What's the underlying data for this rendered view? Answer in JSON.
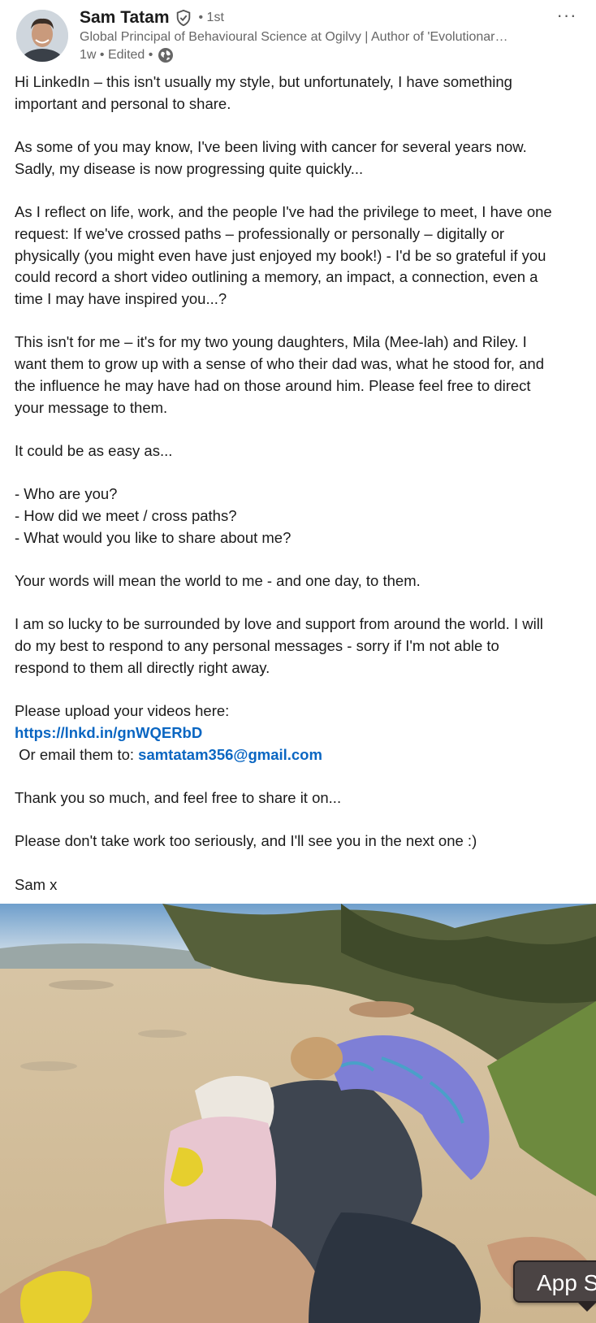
{
  "author": {
    "name": "Sam Tatam",
    "degree": "• 1st",
    "headline": "Global Principal of Behavioural Science at Ogilvy | Author of 'Evolutionar…",
    "meta": "1w • Edited •"
  },
  "icons": {
    "verified": "verified-shield-icon",
    "visibility": "globe-icon",
    "more": "more-options-icon"
  },
  "more_label": "···",
  "post": {
    "p1": [
      "Hi LinkedIn – this isn't usually my style, but unfortunately, I have something",
      "important and personal to share."
    ],
    "p2": [
      "As some of you may know, I've been living with cancer for several years now.",
      "Sadly, my disease is now progressing quite quickly..."
    ],
    "p3": [
      "As I reflect on life, work, and the people I've had the privilege to meet, I have one",
      "request: If we've crossed paths – professionally or personally – digitally or",
      "physically (you might even have just enjoyed my book!) -  I'd be so grateful if you",
      "could record a short video outlining a memory, an impact, a connection, even a",
      "time I may have inspired you...?"
    ],
    "p4": [
      "This isn't for me – it's for my two young daughters, Mila (Mee-lah) and Riley. I",
      "want them to grow up with a sense of who their dad was, what he stood for, and",
      "the influence he may have had on those around him. Please feel free to direct",
      "your message to them."
    ],
    "p5": "It could be as easy as...",
    "questions": [
      "- Who are you?",
      "- How did we meet / cross paths?",
      "- What would you like to share about me?"
    ],
    "p6": "Your words will mean the world to me - and one day, to them.",
    "p7": [
      "I am so lucky to be surrounded by love and support from around the world. I will",
      "do my best to respond to any personal messages - sorry if I'm not able to",
      "respond to them all directly right away."
    ],
    "upload_prompt": "Please upload your videos here:",
    "upload_link": "https://lnkd.in/gnWQERbD",
    "email_prompt": " Or email them to: ",
    "email": "samtatam356@gmail.com",
    "p8": "Thank you so much, and feel free to share it on...",
    "p9": "Please don't take work too seriously, and I'll see you in the next one :)",
    "signoff": "Sam x"
  },
  "app_badge": "App S"
}
